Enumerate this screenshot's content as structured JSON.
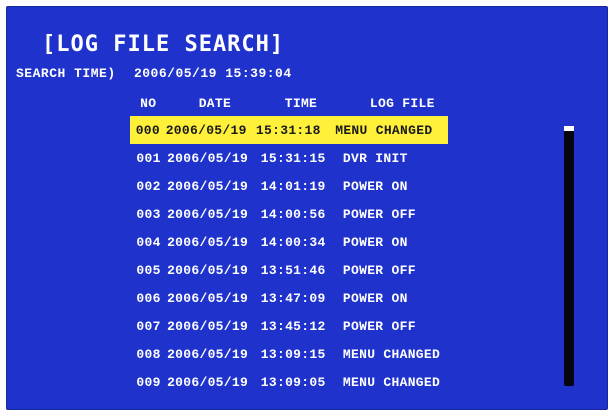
{
  "title": "[LOG FILE SEARCH]",
  "search_time": {
    "label": "SEARCH TIME)",
    "value": "2006/05/19 15:39:04"
  },
  "columns": {
    "no": "NO",
    "date": "DATE",
    "time": "TIME",
    "log_file": "LOG FILE"
  },
  "rows": [
    {
      "no": "000",
      "date": "2006/05/19",
      "time": "15:31:18",
      "event": "MENU CHANGED"
    },
    {
      "no": "001",
      "date": "2006/05/19",
      "time": "15:31:15",
      "event": "DVR INIT"
    },
    {
      "no": "002",
      "date": "2006/05/19",
      "time": "14:01:19",
      "event": "POWER ON"
    },
    {
      "no": "003",
      "date": "2006/05/19",
      "time": "14:00:56",
      "event": "POWER OFF"
    },
    {
      "no": "004",
      "date": "2006/05/19",
      "time": "14:00:34",
      "event": "POWER ON"
    },
    {
      "no": "005",
      "date": "2006/05/19",
      "time": "13:51:46",
      "event": "POWER OFF"
    },
    {
      "no": "006",
      "date": "2006/05/19",
      "time": "13:47:09",
      "event": "POWER ON"
    },
    {
      "no": "007",
      "date": "2006/05/19",
      "time": "13:45:12",
      "event": "POWER OFF"
    },
    {
      "no": "008",
      "date": "2006/05/19",
      "time": "13:09:15",
      "event": "MENU CHANGED"
    },
    {
      "no": "009",
      "date": "2006/05/19",
      "time": "13:09:05",
      "event": "MENU CHANGED"
    }
  ],
  "selected_row": 0,
  "scroll_position": 0,
  "colors": {
    "background": "#1f33cc",
    "text": "#ffffff",
    "highlight": "#fff03a",
    "highlight_text": "#1a1a1a",
    "scrollbar": "#050510"
  }
}
